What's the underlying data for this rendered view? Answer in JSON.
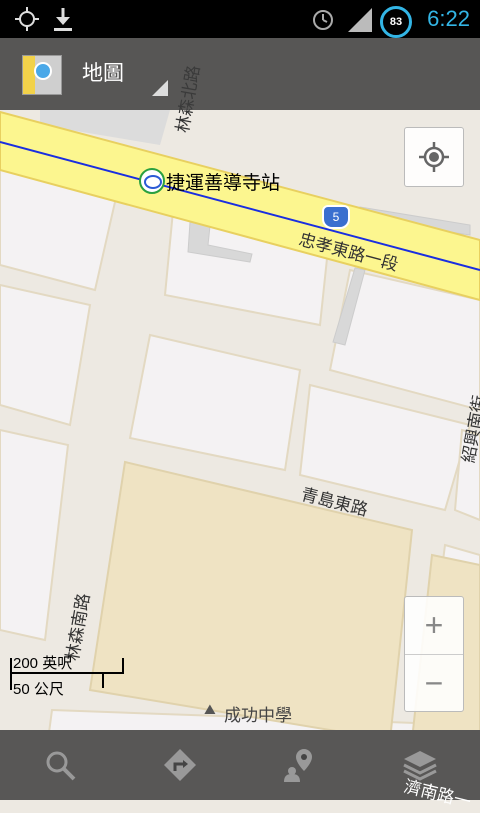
{
  "status_bar": {
    "time": "6:22",
    "battery_level": "83",
    "icons": [
      "gps-icon",
      "download-icon",
      "alarm-icon",
      "signal-icon",
      "battery-icon"
    ]
  },
  "action_bar": {
    "title": "地圖",
    "app_icon": "maps-app-icon"
  },
  "map": {
    "transit_station": "捷運善導寺站",
    "highway_shield": "5",
    "roads": {
      "linsen_north": "林森北路",
      "zhongxiao_east": "忠孝東路一段",
      "shaoxing_south": "紹興南街",
      "qingdao_east": "青島東路",
      "linsen_south": "林森南路",
      "jinan": "濟南路一"
    },
    "poi_school": "成功中學",
    "scale": {
      "imperial": "200 英呎",
      "metric": "50 公尺"
    },
    "colors": {
      "major_road": "#fcf68f",
      "transit_line": "#1a2ee0",
      "school_area": "#efe3c3",
      "block": "#f4f2f3"
    }
  },
  "controls": {
    "zoom_in": "+",
    "zoom_out": "−"
  },
  "bottom_bar": {
    "buttons": [
      "search-icon",
      "directions-icon",
      "places-icon",
      "layers-icon"
    ]
  }
}
